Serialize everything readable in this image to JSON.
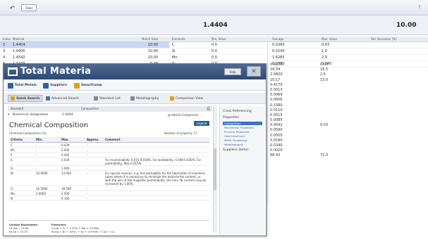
{
  "toolbar": {
    "undo_glyph": "↶",
    "clear_label": "Clear",
    "help_glyph": "?"
  },
  "header": {
    "selected_value": "1.4404",
    "right_value": "10.00"
  },
  "left_table": {
    "headers": [
      "Index",
      "Material",
      "Match Data"
    ],
    "rows": [
      {
        "index": "2",
        "material": "1.4404",
        "match": "10.00",
        "selected": true
      },
      {
        "index": "3",
        "material": "1.4406",
        "match": "10.00",
        "selected": false
      },
      {
        "index": "4",
        "material": "1.4542",
        "match": "10.00",
        "selected": false
      },
      {
        "index": "5",
        "material": "1.4440",
        "match": "9.98",
        "selected": false
      }
    ]
  },
  "right_table": {
    "headers": [
      "Elements",
      "Min. Value",
      "Average",
      "Max. Value",
      "Std. Deviation [%]"
    ],
    "rows": [
      {
        "el": "C",
        "min": "0.0",
        "avg": "0.0260",
        "max": "0.03"
      },
      {
        "el": "Si",
        "min": "0.0",
        "avg": "0.3140",
        "max": "1.0"
      },
      {
        "el": "Mn",
        "min": "0.0",
        "avg": "1.6285",
        "max": "2.0"
      },
      {
        "el": "P",
        "min": "0.0",
        "avg": "0.0380",
        "max": "0.045"
      }
    ],
    "avg_values": [
      "0.0270",
      "16.54",
      "2.0600",
      "10.17",
      "0.4170",
      "0.0013",
      "0.0069",
      "0.0006",
      "0.1580",
      "0.0110",
      "0.0015",
      "0.0085",
      "0.0042",
      "0.0590",
      "0.0500",
      "0.0180",
      "0.0340",
      "0.0020",
      "68.43"
    ],
    "max_values": [
      "0.03",
      "18.5",
      "2.5",
      "13.0",
      "",
      "",
      "",
      "",
      "",
      "",
      "",
      "",
      "0.03",
      "",
      "",
      "",
      "",
      "",
      "71.0"
    ]
  },
  "tm": {
    "logo_text": "Total Materia",
    "help_label": "Help",
    "close_glyph": "✕",
    "nav": [
      {
        "label": "Total Metals",
        "color": "#2f5fa8"
      },
      {
        "label": "Suppliers",
        "color": "#2f5fa8"
      },
      {
        "label": "SmartComp",
        "color": "#e0a020"
      }
    ],
    "tabs": [
      {
        "label": "Quick Search",
        "active": true,
        "color": "#e0a020"
      },
      {
        "label": "Advanced Search",
        "active": false,
        "color": "#4a6fa5"
      },
      {
        "label": "Standard List",
        "active": false,
        "color": "#7b8a9e"
      },
      {
        "label": "Metallography",
        "active": false,
        "color": "#7b8a9e"
      },
      {
        "label": "Comparison View",
        "active": false,
        "color": "#e0a020"
      }
    ],
    "breadcrumb": {
      "left": "Standard",
      "right": "Composition"
    },
    "print_glyph": "⎙",
    "material": {
      "label": "Numerical designation",
      "value": "1.4404"
    },
    "add_comparison": "Add to Comparison",
    "section_title": "Chemical Composition",
    "legend_label": "Legend",
    "subtitle": "Chemical Composition (%)",
    "num_props": "Number of property: 17",
    "ct_headers": [
      "Criteria",
      "Min.",
      "Max.",
      "Approx.",
      "Comment"
    ],
    "ct_rows": [
      {
        "crit": "C",
        "min": "-",
        "max": "0.030",
        "approx": "-",
        "comment": ""
      },
      {
        "crit": "Mn",
        "min": "-",
        "max": "2.000",
        "approx": "-",
        "comment": ""
      },
      {
        "crit": "P",
        "min": "-",
        "max": "0.045",
        "approx": "-",
        "comment": ""
      },
      {
        "crit": "S",
        "min": "-",
        "max": "0.030",
        "approx": "-",
        "comment": "For machinability: 0.015-0.030%. For weldability, 0.008-0.030%. For polishability, Max.0.015%."
      },
      {
        "crit": "Si",
        "min": "-",
        "max": "1.000",
        "approx": "-",
        "comment": ""
      },
      {
        "crit": "Ni",
        "min": "10.0000",
        "max": "13.000",
        "approx": "-",
        "comment": "For special reasons, e.g. hot workability for the fabrication of seamless tubes where it is necessary to minimize the delta-ferrite content, or with the aim of low magnetic permeability, the max. Ni content may be increased by 1.00%."
      },
      {
        "crit": "Cr",
        "min": "16.5000",
        "max": "18.500",
        "approx": "-",
        "comment": ""
      },
      {
        "crit": "Mo",
        "min": "2.0000",
        "max": "2.500",
        "approx": "-",
        "comment": ""
      },
      {
        "crit": "N",
        "min": "-",
        "max": "0.100",
        "approx": "-",
        "comment": ""
      }
    ],
    "carbon": {
      "title": "Carbon Equivalent:",
      "ceq1": "CE-eq = 29.84",
      "ceq2": "Ni-eq = 15.37",
      "formula_title": "Formulas:",
      "f1": "Cr-eq = Cr + 1.5*Si + Mo + 0.5*Nb",
      "f2": "Ni-eq = Ni + 30*(C + N) + 0.5*(Mn + Co) + Cu"
    },
    "side": {
      "items": [
        "Cross Referencing",
        "Properties"
      ],
      "subitems": [
        "Composition",
        "Mechanical Properties",
        "Physical Properties",
        "Heat treatment",
        "Metal Processing",
        "Metallography"
      ],
      "last": "Suppliers (beta)"
    }
  }
}
